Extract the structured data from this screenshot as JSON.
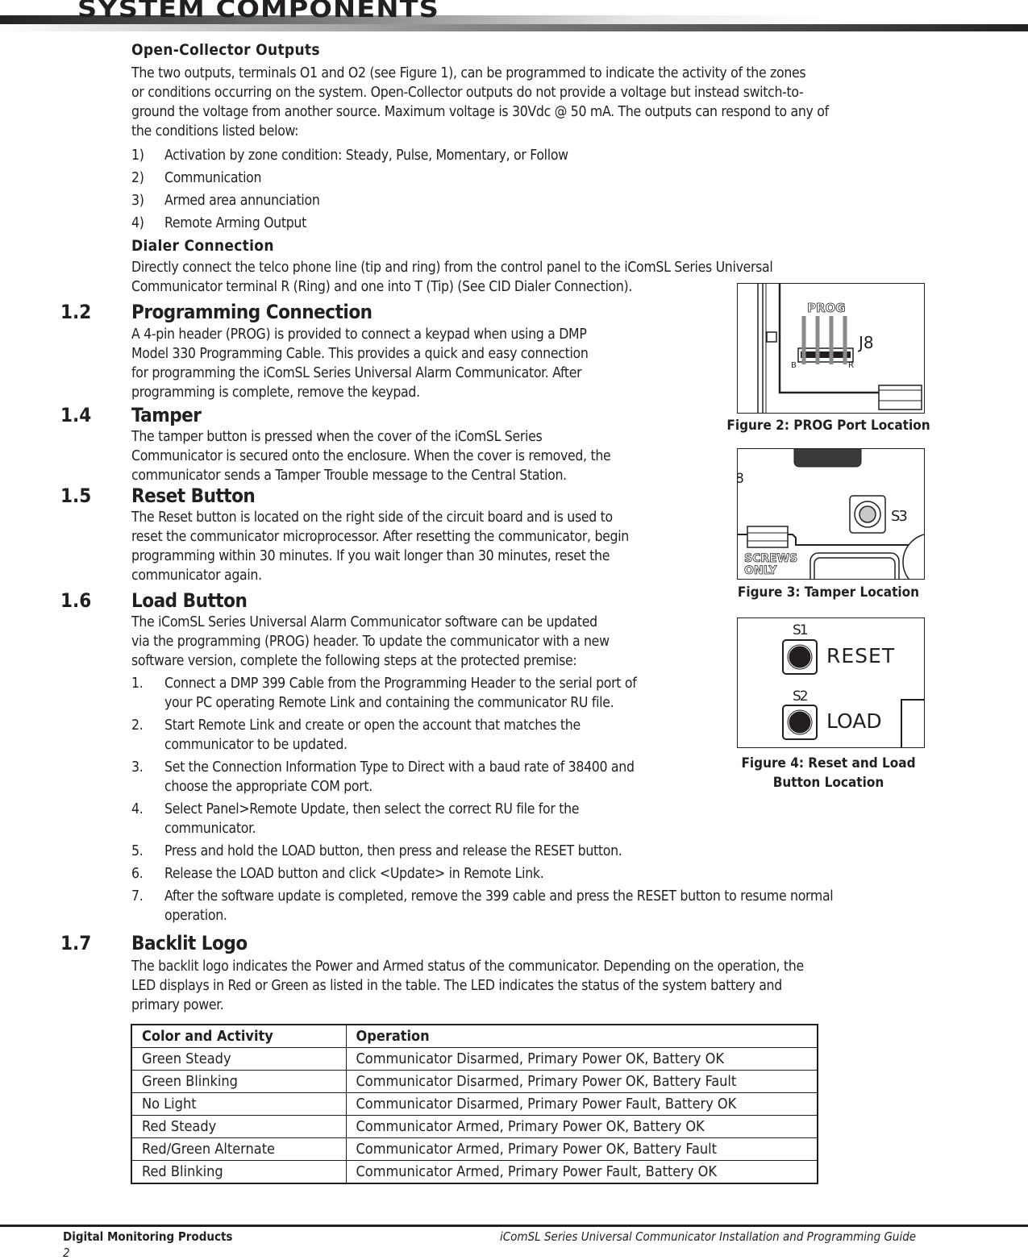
{
  "header": {
    "title": "SYSTEM COMPONENTS"
  },
  "open_collector": {
    "heading": "Open-Collector Outputs",
    "paragraph": [
      "The two outputs, terminals O1 and O2 (see Figure 1), can be programmed to indicate the activity of the zones",
      "or conditions occurring on the system. Open-Collector outputs do not provide a voltage but instead switch-to-",
      "ground the voltage from another source. Maximum voltage is 30Vdc @ 50 mA. The outputs can respond to any of",
      "the conditions listed below:"
    ],
    "items": [
      {
        "num": "1)",
        "text": "Activation by zone condition: Steady, Pulse, Momentary, or Follow"
      },
      {
        "num": "2)",
        "text": "Communication"
      },
      {
        "num": "3)",
        "text": "Armed area annunciation"
      },
      {
        "num": "4)",
        "text": "Remote Arming Output"
      }
    ]
  },
  "dialer": {
    "heading": "Dialer Connection",
    "paragraph": [
      "Directly connect the telco phone line (tip and ring) from the control panel to the iComSL Series Universal",
      "Communicator terminal R (Ring) and one into T (Tip) (See CID Dialer Connection)."
    ]
  },
  "sections": {
    "s12": {
      "num": "1.2",
      "title": "Programming Connection",
      "paragraph": [
        "A 4-pin header (PROG) is provided to connect a keypad when using a DMP",
        "Model 330 Programming Cable. This provides a quick and easy connection",
        "for programming the iComSL Series Universal Alarm Communicator. After",
        "programming is complete, remove the keypad."
      ]
    },
    "s14": {
      "num": "1.4",
      "title": "Tamper",
      "paragraph": [
        "The tamper button is pressed when the cover of the iComSL Series",
        "Communicator is secured onto the enclosure. When the cover is removed, the",
        "communicator sends a Tamper Trouble message to the Central Station."
      ]
    },
    "s15": {
      "num": "1.5",
      "title": "Reset Button",
      "paragraph": [
        "The Reset button is located on the right side of the circuit board and is used to",
        "reset the communicator microprocessor. After resetting the communicator, begin",
        "programming within 30 minutes. If you wait longer than 30 minutes, reset the",
        "communicator again."
      ]
    },
    "s16": {
      "num": "1.6",
      "title": "Load Button",
      "paragraph": [
        "The iComSL Series Universal Alarm Communicator software can be updated",
        "via the programming (PROG) header. To update the communicator with a new",
        "software version, complete the following steps at the protected premise:"
      ],
      "steps": [
        {
          "num": "1.",
          "lines": [
            "Connect a DMP 399 Cable from the Programming Header to the serial port of",
            "your PC operating Remote Link and containing the communicator RU file."
          ]
        },
        {
          "num": "2.",
          "lines": [
            "Start Remote Link and create or open the account that matches the",
            "communicator to be updated."
          ]
        },
        {
          "num": "3.",
          "lines": [
            "Set the Connection Information Type to Direct with a baud rate of 38400 and",
            "choose the appropriate COM port."
          ]
        },
        {
          "num": "4.",
          "lines": [
            "Select Panel>Remote Update, then select the correct RU file for the",
            "communicator."
          ]
        },
        {
          "num": "5.",
          "lines": [
            "Press and hold the LOAD button, then press and release the RESET button."
          ]
        },
        {
          "num": "6.",
          "lines": [
            "Release the LOAD button and click <Update> in Remote Link."
          ]
        },
        {
          "num": "7.",
          "lines": [
            "After the software update is completed, remove the 399 cable and press the RESET button to resume normal",
            "operation."
          ]
        }
      ]
    },
    "s17": {
      "num": "1.7",
      "title": "Backlit Logo",
      "paragraph": [
        "The backlit logo indicates the Power and Armed status of the communicator. Depending on the operation, the",
        "LED displays in Red or Green as listed in the table. The LED indicates the status of the system battery and",
        "primary power."
      ]
    }
  },
  "figures": {
    "fig2": {
      "caption": "Figure 2: PROG Port Location",
      "labels": {
        "prog": "PROG",
        "j8": "J8",
        "b": "B",
        "r": "R"
      }
    },
    "fig3": {
      "caption": "Figure 3: Tamper Location",
      "labels": {
        "s3": "S3",
        "screws": "SCREWS",
        "only": "ONLY",
        "edge": "8"
      }
    },
    "fig4": {
      "caption_lines": [
        "Figure 4: Reset and Load",
        "Button Location"
      ],
      "labels": {
        "s1": "S1",
        "reset": "RESET",
        "s2": "S2",
        "load": "LOAD"
      }
    }
  },
  "led_table": {
    "headers": [
      "Color and Activity",
      "Operation"
    ],
    "rows": [
      [
        "Green Steady",
        "Communicator Disarmed, Primary Power OK, Battery OK"
      ],
      [
        "Green Blinking",
        "Communicator Disarmed, Primary Power OK, Battery Fault"
      ],
      [
        "No Light",
        "Communicator Disarmed, Primary Power Fault, Battery OK"
      ],
      [
        "Red Steady",
        "Communicator Armed, Primary Power OK, Battery OK"
      ],
      [
        "Red/Green Alternate",
        "Communicator Armed, Primary Power OK, Battery Fault"
      ],
      [
        "Red Blinking",
        "Communicator Armed, Primary Power Fault, Battery OK"
      ]
    ]
  },
  "footer": {
    "company": "Digital Monitoring Products",
    "page_number": "2",
    "guide_title": "iComSL Series Universal Communicator Installation and Programming Guide"
  }
}
